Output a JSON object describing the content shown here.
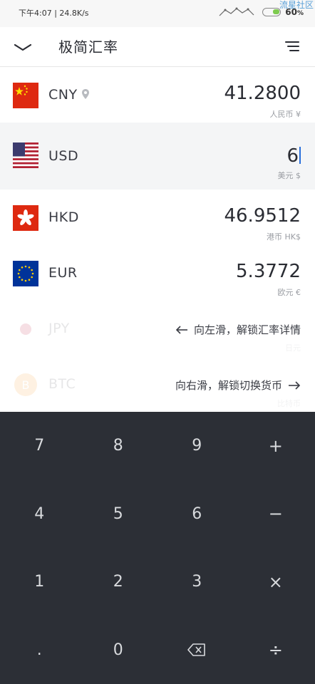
{
  "status": {
    "time_speed": "下午4:07 | 24.8K/s",
    "battery": "60",
    "battery_unit": "%",
    "watermark": "流星社区"
  },
  "header": {
    "title": "极简汇率"
  },
  "currencies": [
    {
      "code": "CNY",
      "amount": "41.2800",
      "name": "人民币 ¥",
      "flag": "cn-flag-icon"
    },
    {
      "code": "USD",
      "amount": "6",
      "name": "美元 $",
      "flag": "us-flag-icon"
    },
    {
      "code": "HKD",
      "amount": "46.9512",
      "name": "港币 HK$",
      "flag": "hk-flag-icon"
    },
    {
      "code": "EUR",
      "amount": "5.3772",
      "name": "欧元 €",
      "flag": "eu-flag-icon"
    },
    {
      "code": "JPY",
      "amount": "",
      "name": "日元",
      "flag": "jp-flag-icon"
    },
    {
      "code": "BTC",
      "amount": "",
      "name": "比特币",
      "flag": "btc-icon"
    }
  ],
  "hints": {
    "swipe_left": "向左滑，解锁汇率详情",
    "swipe_right": "向右滑，解锁切换货币"
  },
  "keypad": {
    "keys": [
      "7",
      "8",
      "9",
      "+",
      "4",
      "5",
      "6",
      "−",
      "1",
      "2",
      "3",
      "×",
      ".",
      "0",
      "⌫",
      "÷"
    ]
  }
}
